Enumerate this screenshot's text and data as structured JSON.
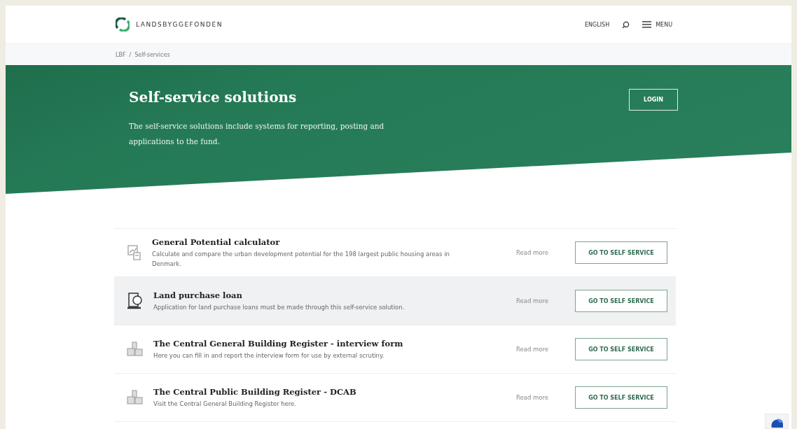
{
  "header": {
    "logo_text": "LANDSBYGGEFONDEN",
    "language": "ENGLISH",
    "menu": "MENU"
  },
  "breadcrumb": [
    "LBF",
    "/",
    "Self-services"
  ],
  "hero": {
    "title": "Self-service solutions",
    "text": "The self-service solutions include systems for reporting, posting and applications to the fund.",
    "login": "LOGIN"
  },
  "services": [
    {
      "kind": "calculator",
      "title": "General Potential calculator",
      "description": "Calculate and compare the urban development potential for the 198 largest public housing areas in Denmark.",
      "read_more": "Read more",
      "action": "GO TO SELF SERVICE",
      "highlighted": false
    },
    {
      "kind": "loan",
      "title": "Land purchase loan",
      "description": "Application for land purchase loans must be made through this self-service solution.",
      "read_more": "Read more",
      "action": "GO TO SELF SERVICE",
      "highlighted": true
    },
    {
      "kind": "building",
      "title": "The Central General Building Register - interview form",
      "description": "Here you can fill in and report the interview form for use by external scrutiny.",
      "read_more": "Read more",
      "action": "GO TO SELF SERVICE",
      "highlighted": false
    },
    {
      "kind": "building",
      "title": "The Central Public Building Register - DCAB",
      "description": "Visit the Central General Building Register here.",
      "read_more": "Read more",
      "action": "GO TO SELF SERVICE",
      "highlighted": false
    }
  ]
}
